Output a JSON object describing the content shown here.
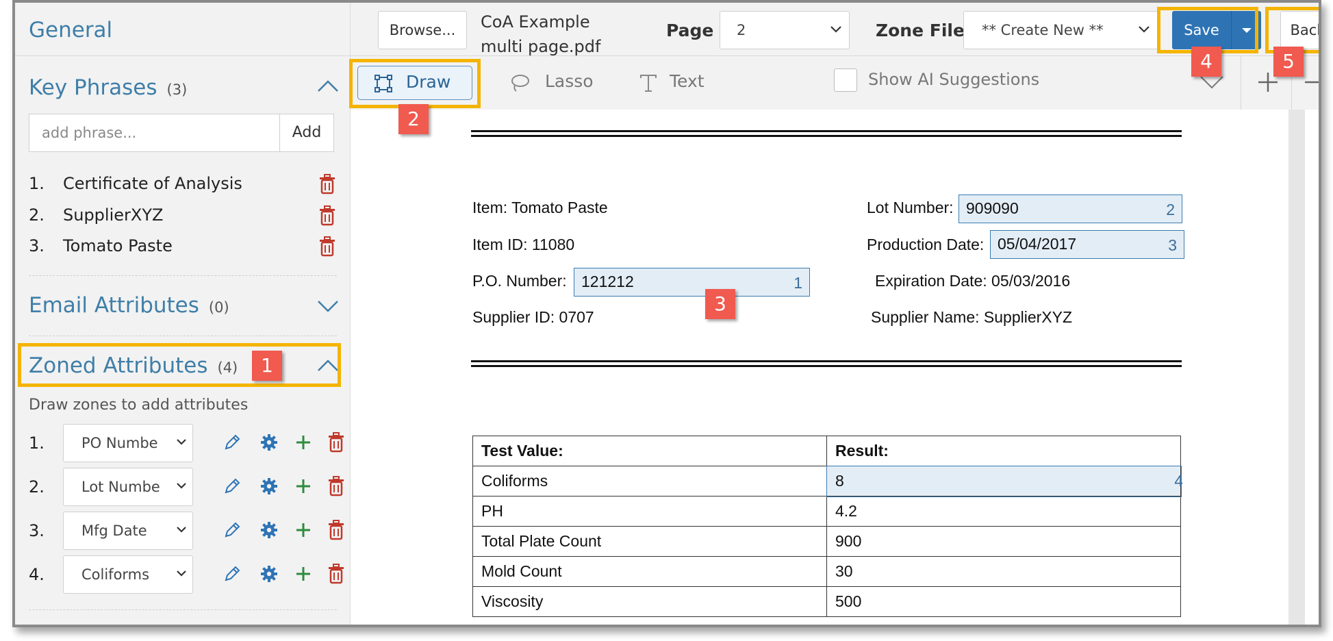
{
  "sidebar": {
    "general_title": "General",
    "key_phrases": {
      "title": "Key Phrases",
      "count": "(3)",
      "input_placeholder": "add phrase...",
      "add_label": "Add",
      "items": [
        {
          "num": "1.",
          "label": "Certificate of Analysis"
        },
        {
          "num": "2.",
          "label": "SupplierXYZ"
        },
        {
          "num": "3.",
          "label": "Tomato Paste"
        }
      ]
    },
    "email_attributes": {
      "title": "Email Attributes",
      "count": "(0)"
    },
    "zoned_attributes": {
      "title": "Zoned Attributes",
      "count": "(4)",
      "hint": "Draw zones to add attributes",
      "items": [
        {
          "num": "1.",
          "value": "PO Numbe"
        },
        {
          "num": "2.",
          "value": "Lot Numbe"
        },
        {
          "num": "3.",
          "value": "Mfg Date"
        },
        {
          "num": "4.",
          "value": "Coliforms"
        }
      ]
    }
  },
  "topbar": {
    "browse_label": "Browse...",
    "file_name_line1": "CoA Example",
    "file_name_line2": "multi page.pdf",
    "page_label": "Page",
    "page_value": "2",
    "zone_file_label": "Zone File",
    "zone_file_value": "** Create New **",
    "save_label": "Save",
    "back_label": "Back"
  },
  "toolbar": {
    "draw_label": "Draw",
    "lasso_label": "Lasso",
    "text_label": "Text",
    "ai_suggestions_label": "Show AI Suggestions",
    "ai_suggestions_checked": false
  },
  "document": {
    "item_label": "Item:  Tomato Paste",
    "item_id_label": "Item ID:  11080",
    "po_label": "P.O. Number:",
    "po_value": "121212",
    "po_zone": "1",
    "supplier_id_label": "Supplier ID: 0707",
    "lot_label": "Lot Number:",
    "lot_value": "909090",
    "lot_zone": "2",
    "prod_date_label": "Production Date:",
    "prod_date_value": "05/04/2017",
    "prod_date_zone": "3",
    "exp_date_label": "Expiration Date:  05/03/2016",
    "supplier_name_label": "Supplier Name: SupplierXYZ",
    "table": {
      "headers": [
        "Test Value:",
        "Result:"
      ],
      "rows": [
        {
          "test": "Coliforms",
          "result": "8",
          "zone": "4"
        },
        {
          "test": "PH",
          "result": "4.2"
        },
        {
          "test": "Total Plate Count",
          "result": "900"
        },
        {
          "test": "Mold Count",
          "result": "30"
        },
        {
          "test": "Viscosity",
          "result": "500"
        }
      ]
    }
  },
  "callouts": [
    "1",
    "2",
    "3",
    "4",
    "5"
  ],
  "colors": {
    "highlight": "#f4b400",
    "badge": "#f05a4f",
    "primary": "#2e74b5",
    "link_blue": "#3f7ea8",
    "trash_red": "#c0392b",
    "gear_blue": "#2e74b5",
    "plus_green": "#2e8b3e"
  }
}
